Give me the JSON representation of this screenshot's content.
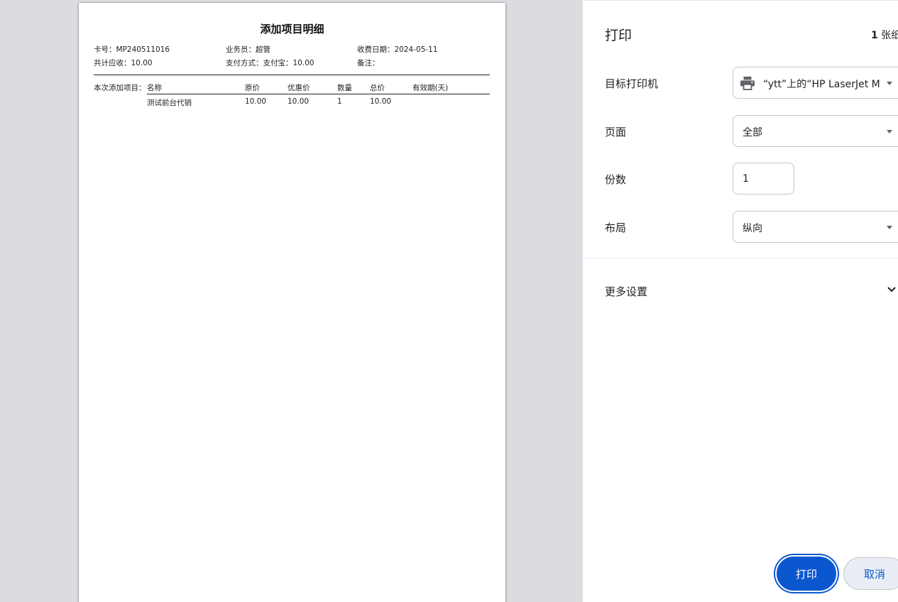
{
  "document": {
    "title": "添加项目明细",
    "card_no": {
      "label": "卡号：",
      "value": "MP240511016"
    },
    "salesperson": {
      "label": "业务员：",
      "value": "超管"
    },
    "charge_date": {
      "label": "收费日期：",
      "value": "2024-05-11"
    },
    "total_due": {
      "label": "共计应收：",
      "value": "10.00"
    },
    "payment_method": {
      "label": "支付方式：",
      "value": "支付宝：10.00"
    },
    "remark": {
      "label": "备注：",
      "value": ""
    },
    "items_label": "本次添加项目：",
    "columns": [
      "名称",
      "原价",
      "优惠价",
      "数量",
      "总价",
      "有效期(天)"
    ],
    "rows": [
      {
        "name": "测试前台代销",
        "original_price": "10.00",
        "discount_price": "10.00",
        "quantity": "1",
        "total": "10.00",
        "validity": ""
      }
    ]
  },
  "settings": {
    "title": "打印",
    "sheet_count": "1",
    "sheet_unit": "张纸",
    "destination": {
      "label": "目标打印机",
      "value": "“ytt”上的“HP LaserJet M",
      "icon": "printer-icon"
    },
    "pages": {
      "label": "页面",
      "value": "全部"
    },
    "copies": {
      "label": "份数",
      "value": "1"
    },
    "layout": {
      "label": "布局",
      "value": "纵向"
    },
    "more_settings": "更多设置",
    "print_label": "打印",
    "cancel_label": "取消"
  },
  "colors": {
    "accent": "#0b57d0",
    "preview_bg": "#dadce0"
  }
}
